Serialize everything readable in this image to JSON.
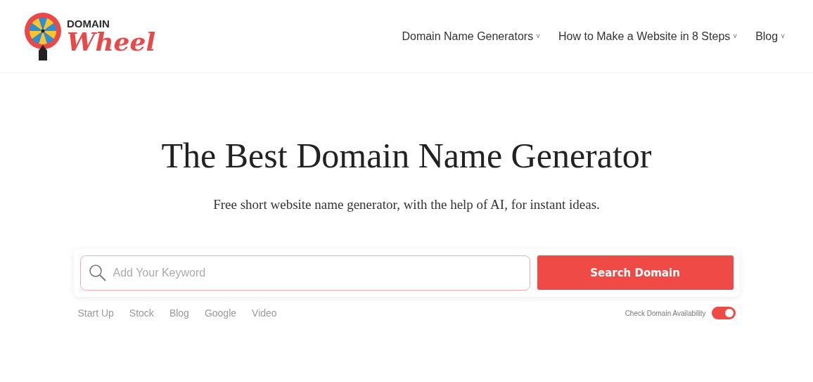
{
  "logo": {
    "top": "DOMAIN",
    "bottom": "Wheel"
  },
  "nav": [
    {
      "label": "Domain Name Generators",
      "caret": "˅"
    },
    {
      "label": "How to Make a Website in 8 Steps",
      "caret": "˅"
    },
    {
      "label": "Blog",
      "caret": "˅"
    }
  ],
  "hero": {
    "title": "The Best Domain Name Generator",
    "subtitle": "Free short website name generator, with the help of AI, for instant ideas."
  },
  "search": {
    "placeholder": "Add Your Keyword",
    "button": "Search Domain"
  },
  "suggestions": [
    "Start Up",
    "Stock",
    "Blog",
    "Google",
    "Video"
  ],
  "availability": {
    "label": "Check Domain Availability",
    "on": true
  }
}
